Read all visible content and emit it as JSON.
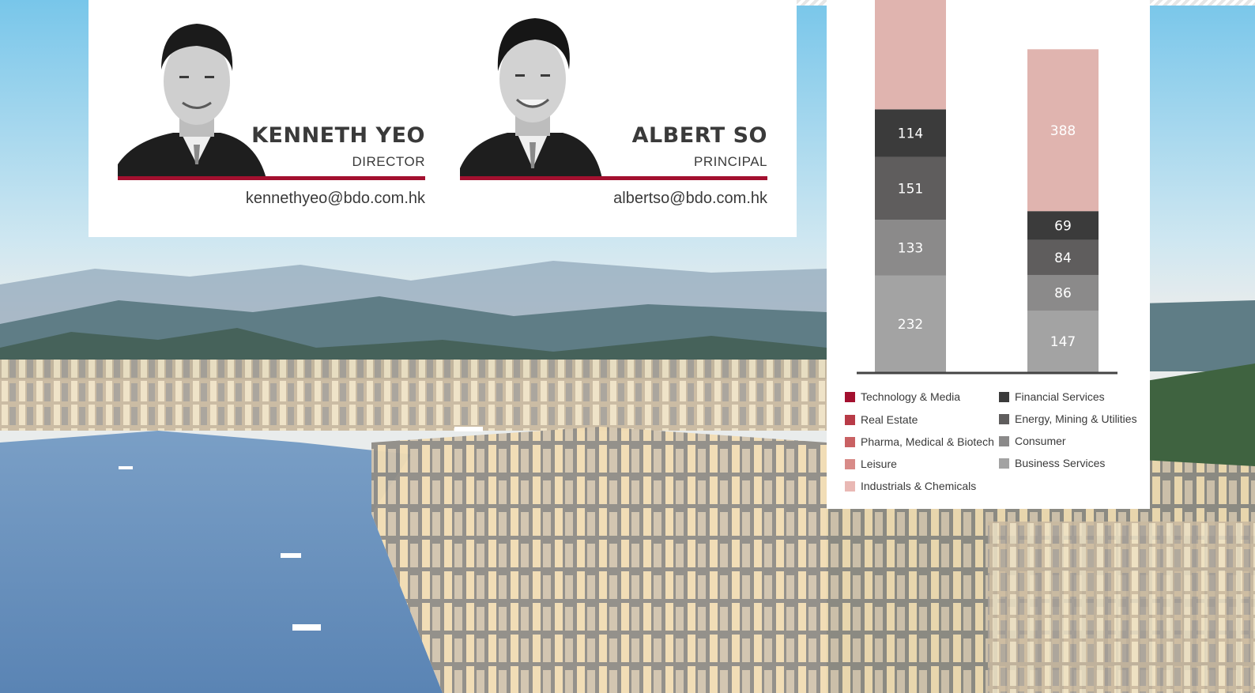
{
  "people": [
    {
      "name": "KENNETH YEO",
      "title": "DIRECTOR",
      "email": "kennethyeo@bdo.com.hk"
    },
    {
      "name": "ALBERT SO",
      "title": "PRINCIPAL",
      "email": "albertso@bdo.com.hk"
    }
  ],
  "colors": {
    "accent": "#a3102f",
    "card_bg": "#ffffff",
    "text": "#3a3a3a"
  },
  "chart_data": {
    "type": "bar",
    "stacked": true,
    "categories": [
      "",
      ""
    ],
    "series": [
      {
        "name": "Business Services",
        "color": "#a3a3a3",
        "values": [
          232,
          147
        ]
      },
      {
        "name": "Consumer",
        "color": "#8b8a8a",
        "values": [
          133,
          86
        ]
      },
      {
        "name": "Energy, Mining & Utilities",
        "color": "#5f5d5d",
        "values": [
          151,
          84
        ]
      },
      {
        "name": "Financial Services",
        "color": "#3b3b3b",
        "values": [
          114,
          69
        ]
      },
      {
        "name": "Industrials & Chemicals",
        "color": "#e0b4af",
        "values": [
          null,
          388
        ]
      }
    ],
    "legend": {
      "placement": "bottom",
      "left_column": [
        {
          "label": "Technology & Media",
          "color": "#a3102f"
        },
        {
          "label": "Real Estate",
          "color": "#b83b47"
        },
        {
          "label": "Pharma, Medical & Biotech",
          "color": "#c96163"
        },
        {
          "label": "Leisure",
          "color": "#d88b88"
        },
        {
          "label": "Industrials & Chemicals",
          "color": "#e9b8b4"
        }
      ],
      "right_column": [
        {
          "label": "Financial Services",
          "color": "#3b3b3b"
        },
        {
          "label": "Energy, Mining & Utilities",
          "color": "#5f5d5d"
        },
        {
          "label": "Consumer",
          "color": "#8b8a8a"
        },
        {
          "label": "Business Services",
          "color": "#a3a3a3"
        }
      ]
    },
    "grid": false
  }
}
